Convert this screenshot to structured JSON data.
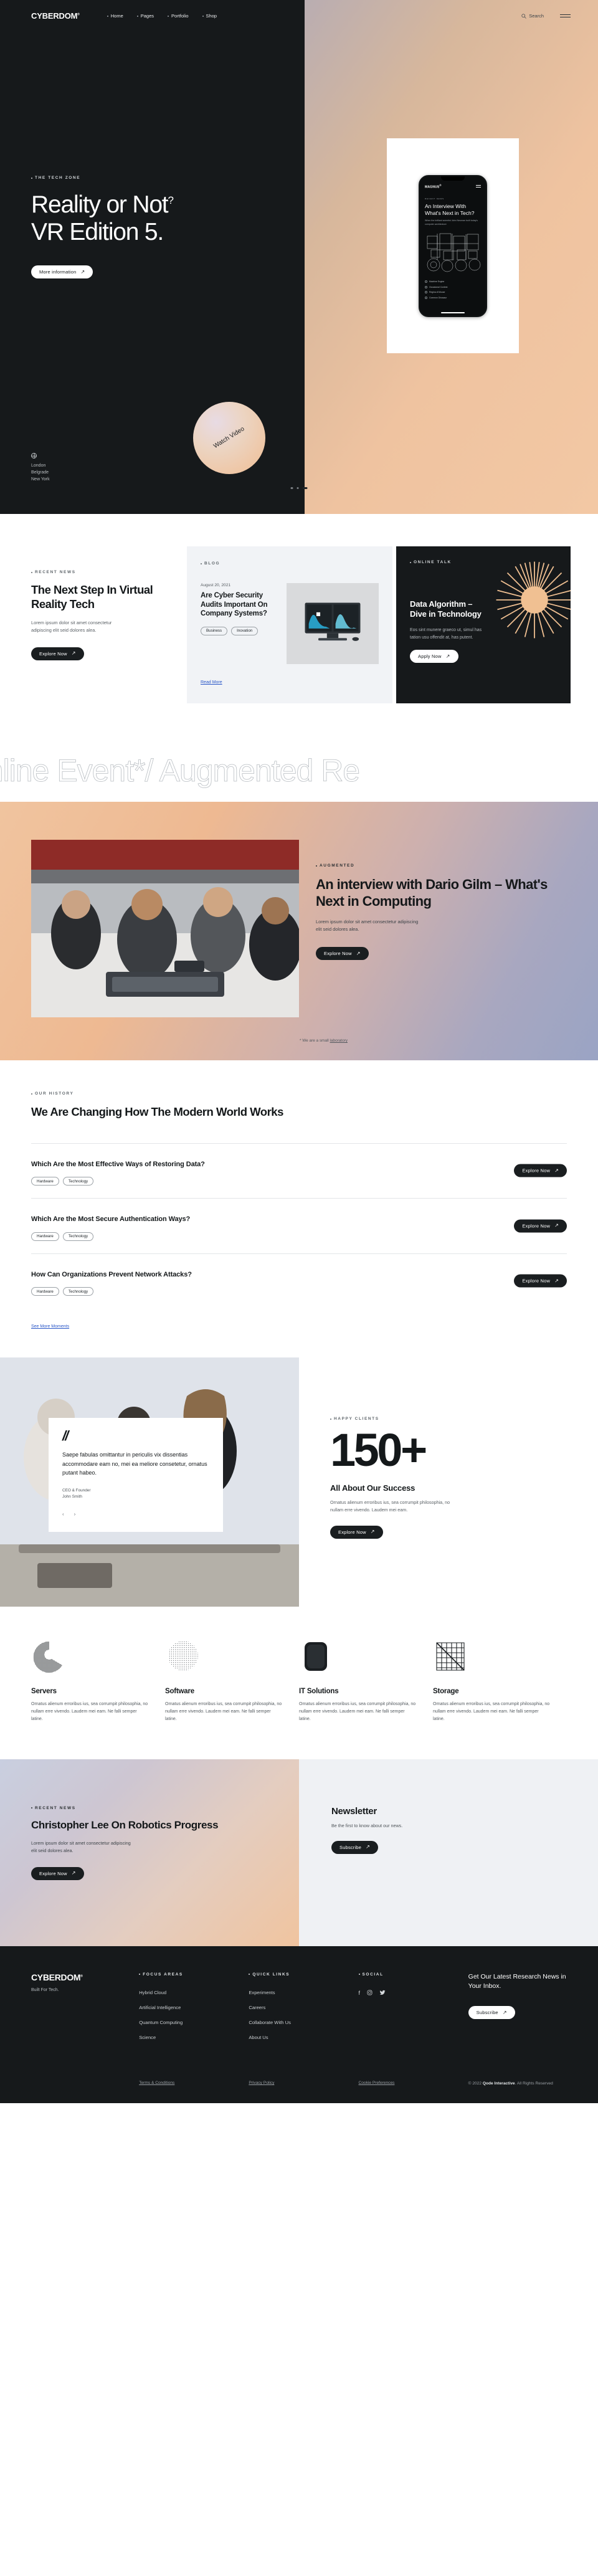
{
  "header": {
    "brand": "CYBERDOM",
    "brand_sup": "®",
    "nav": [
      {
        "label": "Home"
      },
      {
        "label": "Pages"
      },
      {
        "label": "Portfolio"
      },
      {
        "label": "Shop"
      }
    ],
    "search_label": "Search",
    "search_icon": "magnifier-icon",
    "menu_icon": "hamburger-icon"
  },
  "hero": {
    "eyebrow": "THE TECH ZONE",
    "title_line1": "Reality or Not",
    "title_sup": "?",
    "title_line2": "VR Edition 5.",
    "cta": "More information",
    "watch_badge": "Watch Video",
    "locations": [
      "London",
      "Belgrade",
      "New York"
    ],
    "phone": {
      "brand": "MAGNUS",
      "brand_sup": "®",
      "eyebrow": "RECENT NEWS",
      "title": "An Interview With What's Next in Tech?",
      "subtitle": "When the brilliant scientist John Neuman built today's computer architecture",
      "list": [
        "Machine Engine",
        "Occasional Contest",
        "Regina di Mouse",
        "Common Dinosaur"
      ]
    },
    "slider_dots": 3,
    "active_dot": 3
  },
  "news": {
    "eyebrow": "RECENT NEWS",
    "heading": "The Next Step In Virtual Reality Tech",
    "paragraph": "Lorem ipsum dolor sit amet consectetur adipiscing elit seid dolores alea.",
    "cta": "Explore Now"
  },
  "blog": {
    "eyebrow": "BLOG",
    "date": "August 20, 2021",
    "title": "Are Cyber Security Audits Important On Company Systems?",
    "tags": [
      "Business",
      "Inovation"
    ],
    "read_more": "Read More",
    "thumb_alt": "desktop-monitor-analytics"
  },
  "talk": {
    "eyebrow": "ONLINE TALK",
    "title": "Data Algorithm – Dive in Technology",
    "paragraph": "Eos sint munere graeco ut, simul has tation usu offendit at, has putent.",
    "cta": "Apply Now",
    "burst_color": "#f0c092"
  },
  "marquee": {
    "text": "al Online Event*/ Augmented Re"
  },
  "interview": {
    "eyebrow": "AUGMENTED",
    "heading": "An interview with Dario Gilm – What's Next in Computing",
    "paragraph": "Lorem ipsum dolor sit amet consectetur adipiscing elit seid dolores alea.",
    "cta": "Explore Now",
    "note_prefix": "* We are a small ",
    "note_link": "laboratory",
    "image_alt": "team-working-on-hardware"
  },
  "history": {
    "eyebrow": "OUR HISTORY",
    "heading": "We Are Changing How The Modern World Works",
    "items": [
      {
        "question": "Which Are the Most Effective Ways of Restoring Data?",
        "tags": [
          "Hardware",
          "Technology"
        ],
        "cta": "Explore Now"
      },
      {
        "question": "Which Are the Most Secure Authentication Ways?",
        "tags": [
          "Hardware",
          "Technology"
        ],
        "cta": "Explore Now"
      },
      {
        "question": "How Can Organizations Prevent Network Attacks?",
        "tags": [
          "Hardware",
          "Technology"
        ],
        "cta": "Explore Now"
      }
    ],
    "see_more": "See More Moments"
  },
  "testimonial": {
    "quote_mark": "//",
    "text": "Saepe fabulas omittantur in periculis vix dissentias accommodare eam no, mei ea meliore consetetur, ornatus putant habeo.",
    "role": "CEO & Founder",
    "author": "John Smith",
    "prev_icon": "chevron-left-icon",
    "next_icon": "chevron-right-icon",
    "image_alt": "two-women-collaborating"
  },
  "stats": {
    "eyebrow": "HAPPY CLIENTS",
    "number": "150+",
    "heading": "All About Our Success",
    "paragraph": "Ornatus alienum erroribus ius, sea corrumpit philosophia, no nullam erre vivendo. Laudem mei eam.",
    "cta": "Explore Now"
  },
  "services": [
    {
      "icon": "halftone-arc-icon",
      "title": "Servers",
      "text": "Ornatus alienum erroribus ius, sea corrumpit philosophia, no nullam erre vivendo. Laudem mei eam. Ne falli semper latine."
    },
    {
      "icon": "dotted-sphere-icon",
      "title": "Software",
      "text": "Ornatus alienum erroribus ius, sea corrumpit philosophia, no nullam erre vivendo. Laudem mei eam. Ne falli semper latine."
    },
    {
      "icon": "rounded-cube-icon",
      "title": "IT Solutions",
      "text": "Ornatus alienum erroribus ius, sea corrumpit philosophia, no nullam erre vivendo. Laudem mei eam. Ne falli semper latine."
    },
    {
      "icon": "grid-lines-icon",
      "title": "Storage",
      "text": "Ornatus alienum erroribus ius, sea corrumpit philosophia, no nullam erre vivendo. Laudem mei eam. Ne falli semper latine."
    }
  ],
  "robotics": {
    "eyebrow": "RECENT NEWS",
    "heading": "Christopher Lee On Robotics Progress",
    "paragraph": "Lorem ipsum dolor sit amet consectetur adipiscing elit seid dolores alea.",
    "cta": "Explore Now"
  },
  "newsletter": {
    "heading": "Newsletter",
    "paragraph": "Be the first to know about our news.",
    "cta": "Subscribe"
  },
  "footer": {
    "brand": "CYBERDOM",
    "brand_sup": "®",
    "tagline": "Built For Tech.",
    "col1": {
      "title": "FOCUS AREAS",
      "links": [
        "Hybrid Cloud",
        "Artificial Intelligence",
        "Quantum Computing",
        "Science"
      ]
    },
    "col2": {
      "title": "QUICK LINKS",
      "links": [
        "Experiments",
        "Careers",
        "Collaborate With Us",
        "About Us"
      ]
    },
    "col3": {
      "title": "SOCIAL",
      "icons": [
        "facebook-icon",
        "instagram-icon",
        "twitter-icon"
      ]
    },
    "nl_heading": "Get Our Latest Research News in Your Inbox.",
    "nl_cta": "Subscribe",
    "legal": [
      "Terms & Conditions",
      "Privacy Policy",
      "Cookie Preferences"
    ],
    "copyright_pre": "© 2022 ",
    "copyright_brand": "Qode Interactive",
    "copyright_post": ". All Rights Reserved"
  }
}
